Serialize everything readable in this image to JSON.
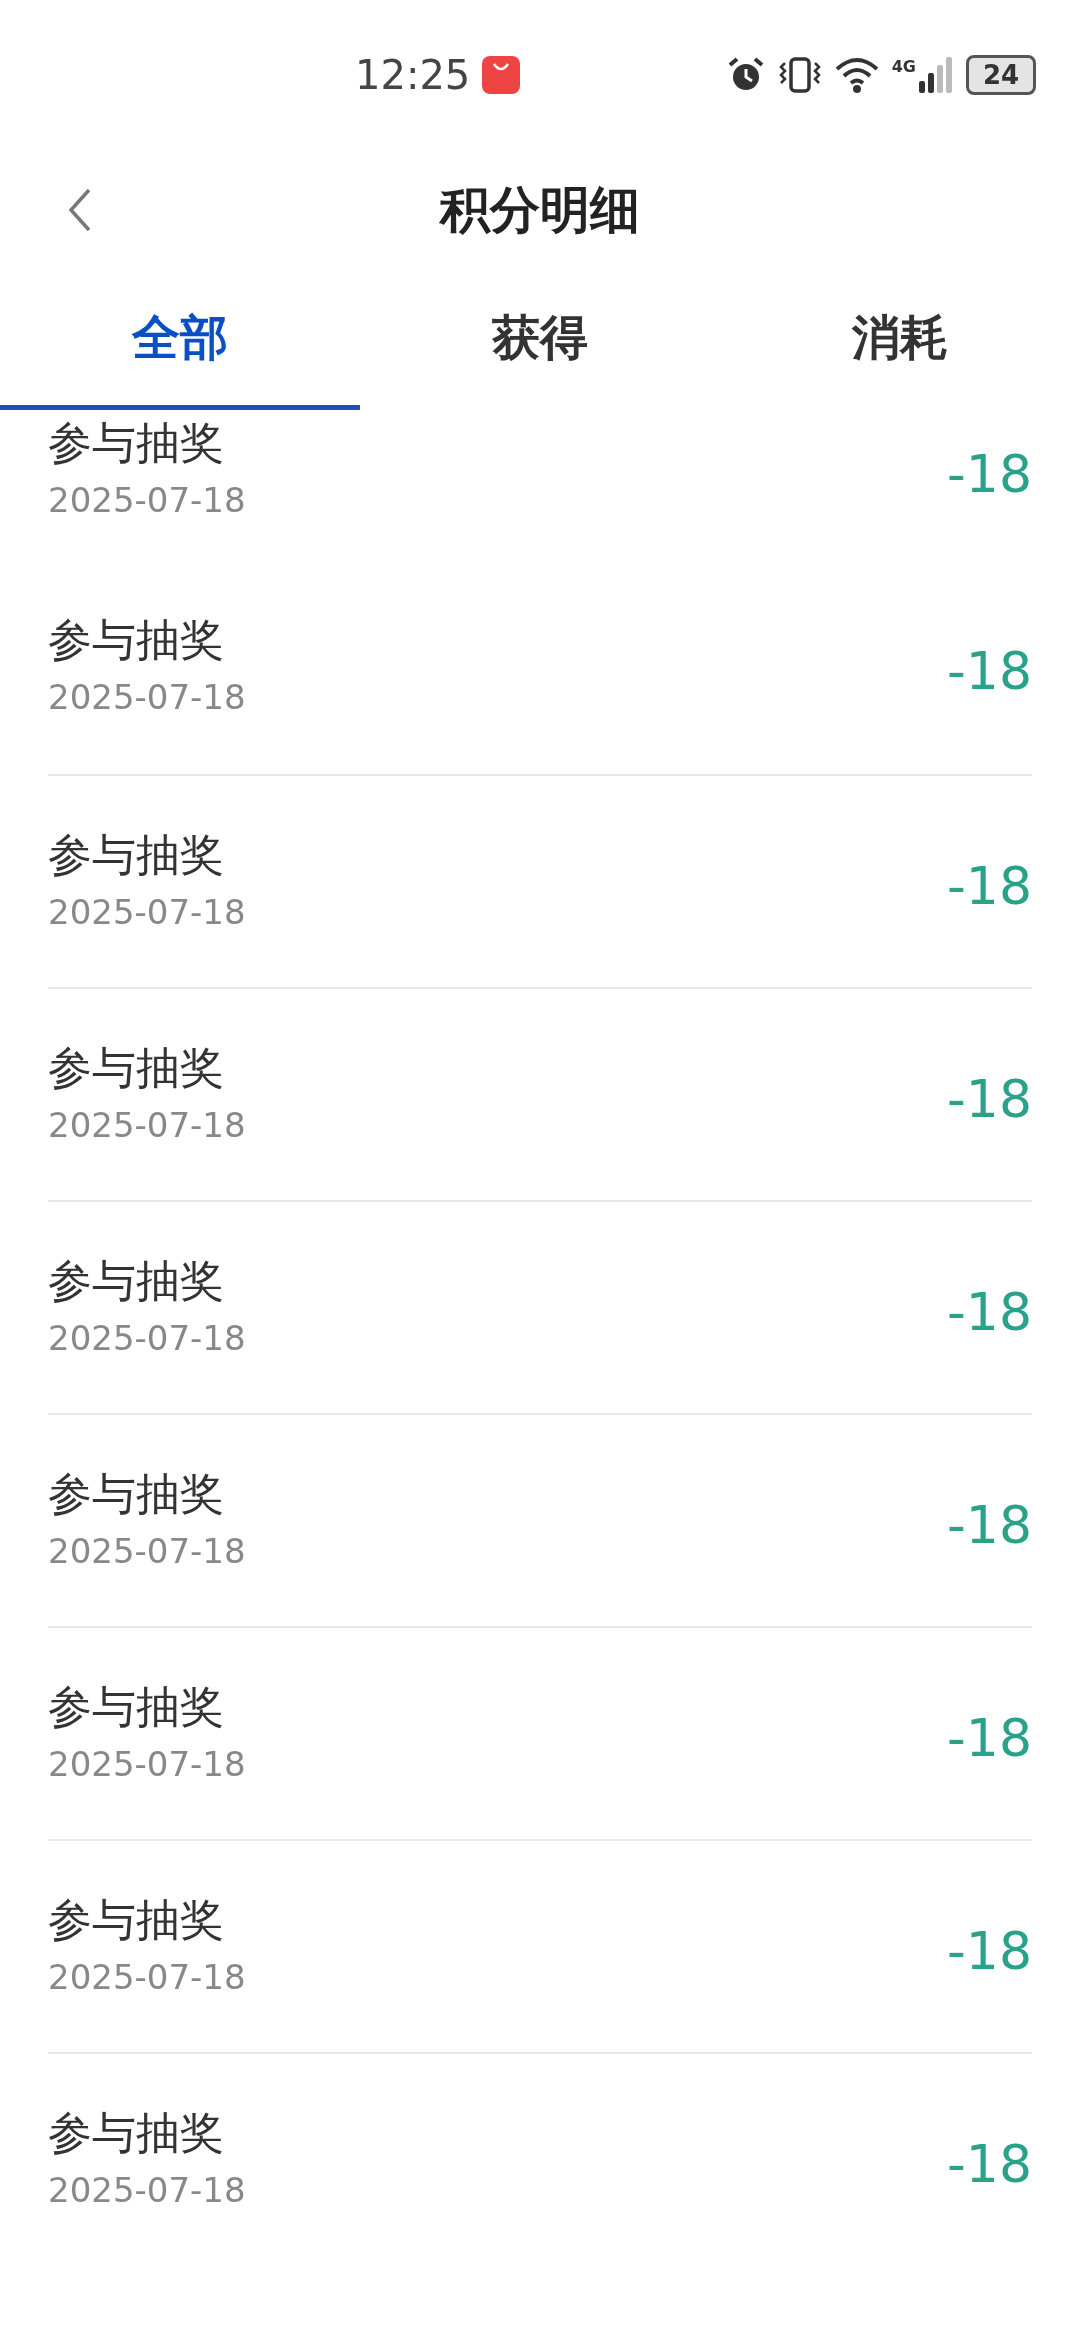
{
  "status_bar": {
    "time": "12:25",
    "network": "4G",
    "battery": "24"
  },
  "header": {
    "title": "积分明细"
  },
  "tabs": [
    {
      "label": "全部",
      "selected": true
    },
    {
      "label": "获得",
      "selected": false
    },
    {
      "label": "消耗",
      "selected": false
    }
  ],
  "records": [
    {
      "title": "参与抽奖",
      "date": "2025-07-18",
      "points": "-18"
    },
    {
      "title": "参与抽奖",
      "date": "2025-07-18",
      "points": "-18"
    },
    {
      "title": "参与抽奖",
      "date": "2025-07-18",
      "points": "-18"
    },
    {
      "title": "参与抽奖",
      "date": "2025-07-18",
      "points": "-18"
    },
    {
      "title": "参与抽奖",
      "date": "2025-07-18",
      "points": "-18"
    },
    {
      "title": "参与抽奖",
      "date": "2025-07-18",
      "points": "-18"
    },
    {
      "title": "参与抽奖",
      "date": "2025-07-18",
      "points": "-18"
    },
    {
      "title": "参与抽奖",
      "date": "2025-07-18",
      "points": "-18"
    },
    {
      "title": "参与抽奖",
      "date": "2025-07-18",
      "points": "-18"
    }
  ]
}
